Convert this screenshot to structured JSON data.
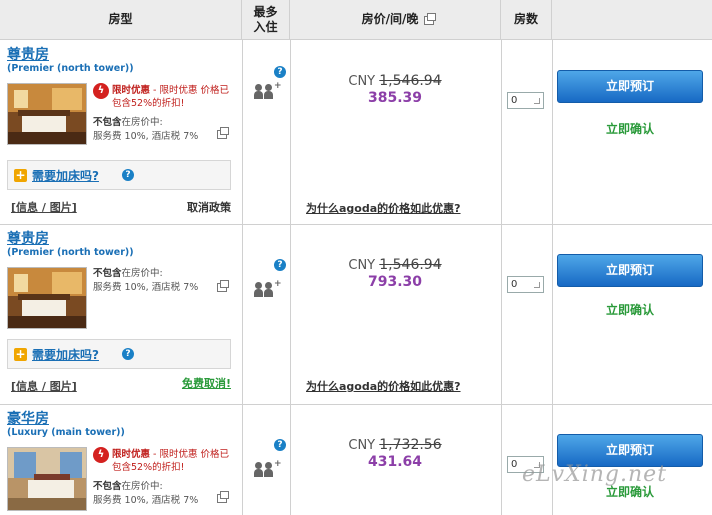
{
  "header": {
    "room_type": "房型",
    "max_occupancy": "最多入住",
    "price": "房价/间/晚",
    "rooms": "房数"
  },
  "rooms": [
    {
      "name": "尊贵房",
      "subtitle": "(Premier (north tower))",
      "promo_label": "限时优惠",
      "promo_text": " - 限时优惠 价格已包含52%的折扣!",
      "excl_label": "不包含",
      "excl_suffix": "在房价中:",
      "excl_detail": "服务费 10%, 酒店税 7%",
      "extra_bed": "需要加床吗?",
      "info_link": "[信息 / 图片]",
      "cancel": "取消政策",
      "currency": "CNY",
      "original_price": "1,546.94",
      "deal_price": "385.39",
      "why_link": "为什么agoda的价格如此优惠?",
      "qty": "0",
      "book_label": "立即预订",
      "confirm": "立即确认"
    },
    {
      "name": "尊贵房",
      "subtitle": "(Premier (north tower))",
      "excl_label": "不包含",
      "excl_suffix": "在房价中:",
      "excl_detail": "服务费 10%, 酒店税 7%",
      "extra_bed": "需要加床吗?",
      "info_link": "[信息 / 图片]",
      "cancel": "免费取消!",
      "currency": "CNY",
      "original_price": "1,546.94",
      "deal_price": "793.30",
      "why_link": "为什么agoda的价格如此优惠?",
      "qty": "0",
      "book_label": "立即预订",
      "confirm": "立即确认"
    },
    {
      "name": "豪华房",
      "subtitle": "(Luxury (main tower))",
      "promo_label": "限时优惠",
      "promo_text": " - 限时优惠 价格已包含52%的折扣!",
      "excl_label": "不包含",
      "excl_suffix": "在房价中:",
      "excl_detail": "服务费 10%, 酒店税 7%",
      "currency": "CNY",
      "original_price": "1,732.56",
      "deal_price": "431.64",
      "qty": "0",
      "book_label": "立即预订",
      "confirm": "立即确认"
    }
  ],
  "watermark": "eLvXing.net",
  "colors": {
    "link": "#1a6fb5",
    "deal_price": "#8c3fa8",
    "confirm_green": "#2a9a3a",
    "promo_red": "#c0201d",
    "book_button": "#1769c4"
  }
}
